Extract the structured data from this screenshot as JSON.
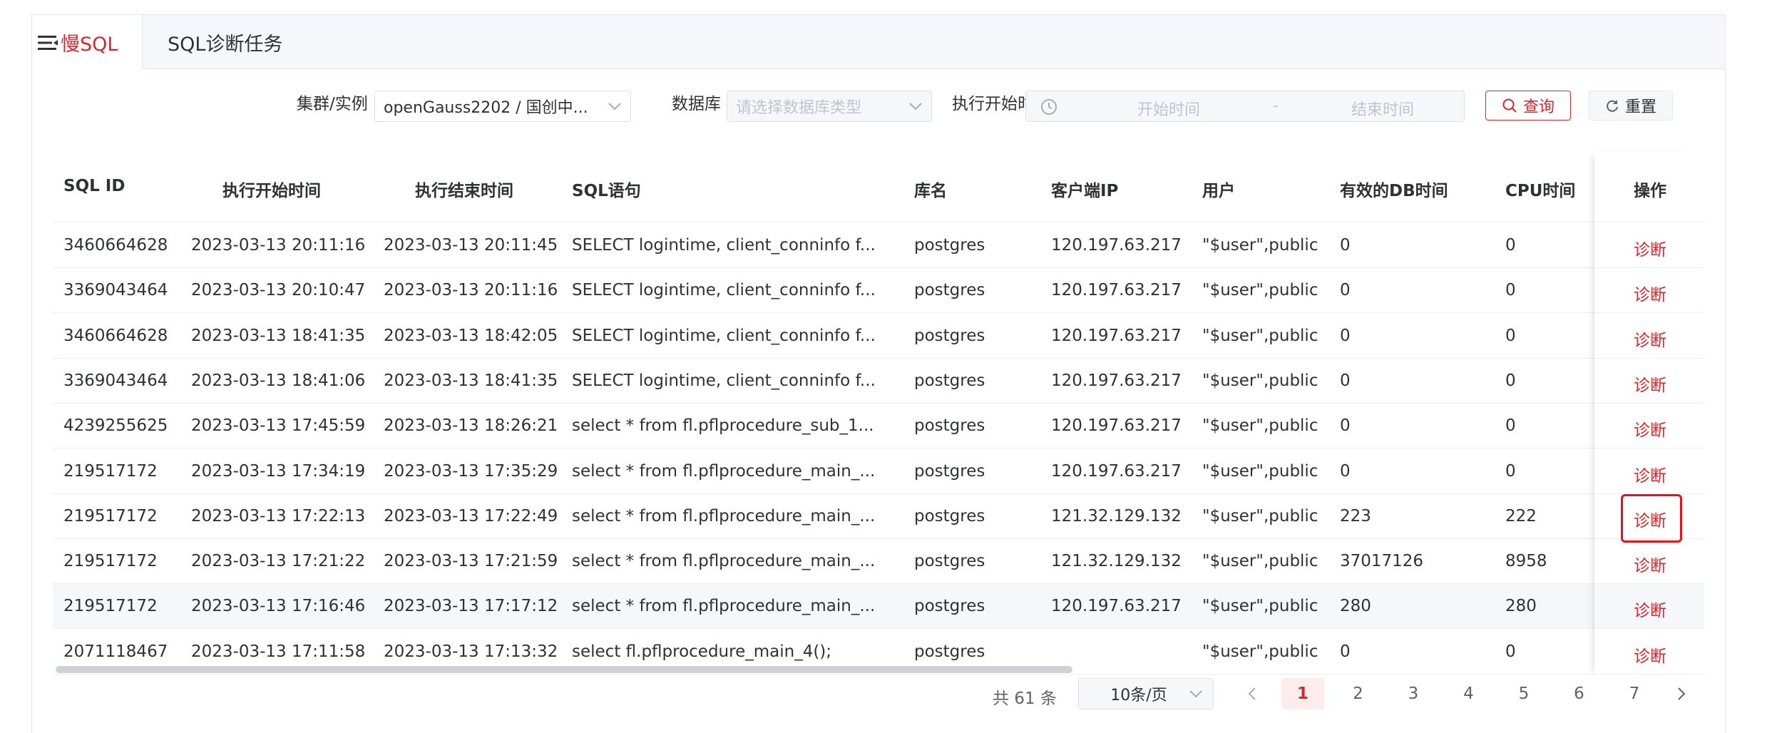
{
  "tabs": [
    {
      "label": "慢SQL",
      "active": true
    },
    {
      "label": "SQL诊断任务",
      "active": false
    }
  ],
  "filters": {
    "cluster_label": "集群/实例",
    "cluster_value": "openGauss2202 / 国创中...",
    "db_label": "数据库",
    "db_placeholder": "请选择数据库类型",
    "time_label": "执行开始时间",
    "start_placeholder": "开始时间",
    "range_separator": "-",
    "end_placeholder": "结束时间",
    "search_label": "查询",
    "reset_label": "重置"
  },
  "table": {
    "columns": [
      "SQL ID",
      "执行开始时间",
      "执行结束时间",
      "SQL语句",
      "库名",
      "客户端IP",
      "用户",
      "有效的DB时间",
      "CPU时间",
      "操作"
    ],
    "action_label": "诊断",
    "rows": [
      [
        "3460664628",
        "2023-03-13 20:11:16",
        "2023-03-13 20:11:45",
        "SELECT logintime, client_conninfo f...",
        "postgres",
        "120.197.63.217",
        "\"$user\",public",
        "0",
        "0"
      ],
      [
        "3369043464",
        "2023-03-13 20:10:47",
        "2023-03-13 20:11:16",
        "SELECT logintime, client_conninfo f...",
        "postgres",
        "120.197.63.217",
        "\"$user\",public",
        "0",
        "0"
      ],
      [
        "3460664628",
        "2023-03-13 18:41:35",
        "2023-03-13 18:42:05",
        "SELECT logintime, client_conninfo f...",
        "postgres",
        "120.197.63.217",
        "\"$user\",public",
        "0",
        "0"
      ],
      [
        "3369043464",
        "2023-03-13 18:41:06",
        "2023-03-13 18:41:35",
        "SELECT logintime, client_conninfo f...",
        "postgres",
        "120.197.63.217",
        "\"$user\",public",
        "0",
        "0"
      ],
      [
        "4239255625",
        "2023-03-13 17:45:59",
        "2023-03-13 18:26:21",
        "select * from fl.pflprocedure_sub_1...",
        "postgres",
        "120.197.63.217",
        "\"$user\",public",
        "0",
        "0"
      ],
      [
        "219517172",
        "2023-03-13 17:34:19",
        "2023-03-13 17:35:29",
        "select * from fl.pflprocedure_main_...",
        "postgres",
        "120.197.63.217",
        "\"$user\",public",
        "0",
        "0"
      ],
      [
        "219517172",
        "2023-03-13 17:22:13",
        "2023-03-13 17:22:49",
        "select * from fl.pflprocedure_main_...",
        "postgres",
        "121.32.129.132",
        "\"$user\",public",
        "223",
        "222"
      ],
      [
        "219517172",
        "2023-03-13 17:21:22",
        "2023-03-13 17:21:59",
        "select * from fl.pflprocedure_main_...",
        "postgres",
        "121.32.129.132",
        "\"$user\",public",
        "37017126",
        "8958"
      ],
      [
        "219517172",
        "2023-03-13 17:16:46",
        "2023-03-13 17:17:12",
        "select * from fl.pflprocedure_main_...",
        "postgres",
        "120.197.63.217",
        "\"$user\",public",
        "280",
        "280"
      ],
      [
        "2071118467",
        "2023-03-13 17:11:58",
        "2023-03-13 17:13:32",
        "select fl.pflprocedure_main_4();",
        "postgres",
        "",
        "\"$user\",public",
        "0",
        "0"
      ]
    ]
  },
  "pagination": {
    "total_text": "共 61 条",
    "page_size": "10条/页",
    "pages": [
      "1",
      "2",
      "3",
      "4",
      "5",
      "6",
      "7"
    ],
    "current": "1"
  },
  "colors": {
    "accent": "#d9262b"
  }
}
